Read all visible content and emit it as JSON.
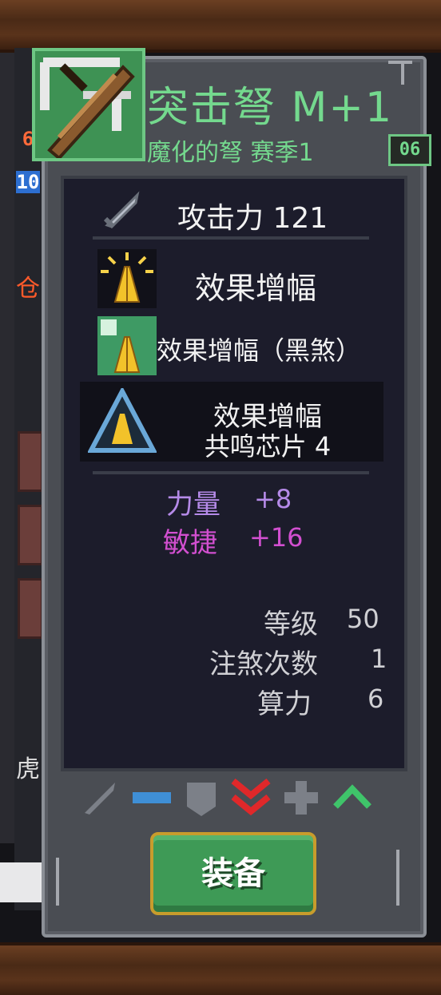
{
  "item": {
    "name": "突击弩 M+1",
    "subtitle": "魔化的弩 赛季1",
    "season_badge": "06"
  },
  "stats": {
    "attack_label": "攻击力 121"
  },
  "effects": [
    {
      "label": "效果增幅",
      "icon": "praying-hands-icon"
    },
    {
      "label": "效果增幅（黑煞）",
      "icon": "praying-hands-dark-icon"
    }
  ],
  "resonance": {
    "line1": "效果增幅",
    "line2": "共鸣芯片 4",
    "icon": "warning-triangle-hands-icon"
  },
  "attributes": [
    {
      "name": "力量",
      "value": "+8",
      "color": "#b58ae8"
    },
    {
      "name": "敏捷",
      "value": "+16",
      "color": "#d24fd0"
    }
  ],
  "info": [
    {
      "label": "等级",
      "value": "50"
    },
    {
      "label": "注煞次数",
      "value": "1"
    },
    {
      "label": "算力",
      "value": "6"
    }
  ],
  "compare_icons": [
    "sword-compare-icon",
    "minus-icon",
    "shield-icon",
    "double-down-arrow-icon",
    "plus-icon",
    "up-arrow-icon"
  ],
  "equip_button": {
    "label": "装备"
  },
  "background": {
    "num1": "6",
    "num2": "10",
    "char1": "仓",
    "char2": "虎"
  },
  "colors": {
    "title_green": "#74d98e",
    "panel_gray": "#4a4d53",
    "inner_dark": "#1c1c2b",
    "button_green": "#3e9a56",
    "button_border": "#c89c2c"
  }
}
